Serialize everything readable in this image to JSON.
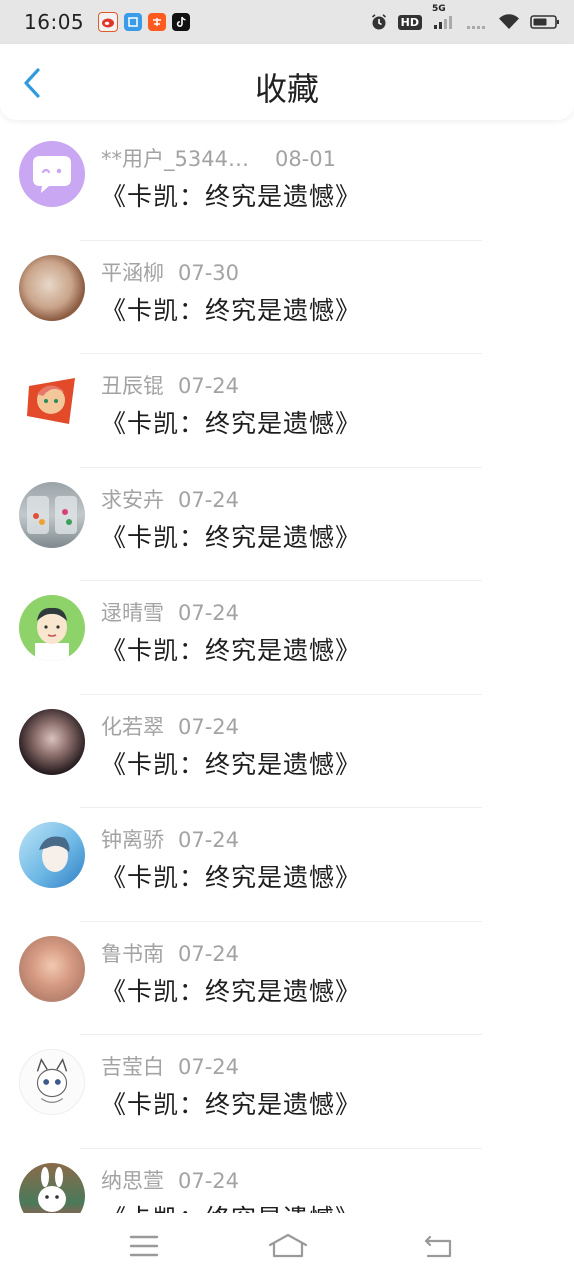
{
  "status_bar": {
    "time": "16:05",
    "app_icons": [
      "weibo-icon",
      "app-icon-blue",
      "taobao-icon",
      "tiktok-icon"
    ],
    "hd_label": "HD",
    "network_label": "5G"
  },
  "header": {
    "title": "收藏",
    "back_icon": "chevron-left-icon",
    "accent_color": "#2f9ae0"
  },
  "favorites": [
    {
      "name": "**用户_5344…",
      "date": "08-01",
      "title": "《卡凯：终究是遗憾》"
    },
    {
      "name": "平涵柳",
      "date": "07-30",
      "title": "《卡凯：终究是遗憾》"
    },
    {
      "name": "丑辰锟",
      "date": "07-24",
      "title": "《卡凯：终究是遗憾》"
    },
    {
      "name": "求安卉",
      "date": "07-24",
      "title": "《卡凯：终究是遗憾》"
    },
    {
      "name": "逯晴雪",
      "date": "07-24",
      "title": "《卡凯：终究是遗憾》"
    },
    {
      "name": "化若翠",
      "date": "07-24",
      "title": "《卡凯：终究是遗憾》"
    },
    {
      "name": "钟离骄",
      "date": "07-24",
      "title": "《卡凯：终究是遗憾》"
    },
    {
      "name": "鲁书南",
      "date": "07-24",
      "title": "《卡凯：终究是遗憾》"
    },
    {
      "name": "吉莹白",
      "date": "07-24",
      "title": "《卡凯：终究是遗憾》"
    },
    {
      "name": "纳思萱",
      "date": "07-24",
      "title": "《卡凯：终究是遗憾》"
    }
  ],
  "nav_bar": {
    "icons": [
      "menu-icon",
      "home-icon",
      "back-icon"
    ]
  }
}
